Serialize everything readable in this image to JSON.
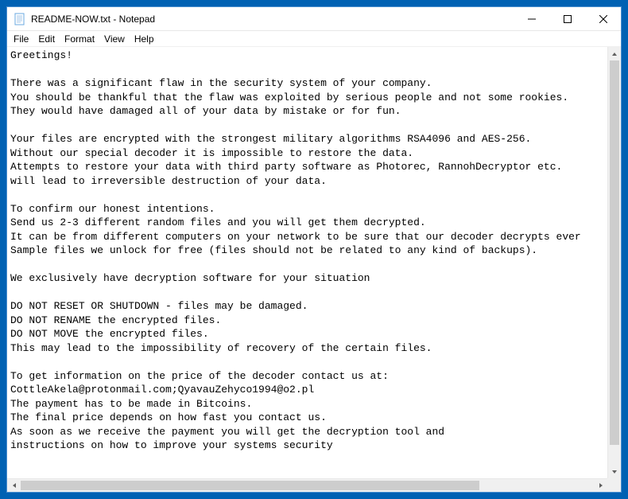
{
  "titlebar": {
    "title": "README-NOW.txt - Notepad"
  },
  "menubar": {
    "items": [
      "File",
      "Edit",
      "Format",
      "View",
      "Help"
    ]
  },
  "document": {
    "body": "Greetings!\n\nThere was a significant flaw in the security system of your company.\nYou should be thankful that the flaw was exploited by serious people and not some rookies.\nThey would have damaged all of your data by mistake or for fun.\n\nYour files are encrypted with the strongest military algorithms RSA4096 and AES-256.\nWithout our special decoder it is impossible to restore the data.\nAttempts to restore your data with third party software as Photorec, RannohDecryptor etc.\nwill lead to irreversible destruction of your data.\n\nTo confirm our honest intentions.\nSend us 2-3 different random files and you will get them decrypted.\nIt can be from different computers on your network to be sure that our decoder decrypts ever\nSample files we unlock for free (files should not be related to any kind of backups).\n\nWe exclusively have decryption software for your situation\n\nDO NOT RESET OR SHUTDOWN - files may be damaged.\nDO NOT RENAME the encrypted files.\nDO NOT MOVE the encrypted files.\nThis may lead to the impossibility of recovery of the certain files.\n\nTo get information on the price of the decoder contact us at:\nCottleAkela@protonmail.com;QyavauZehyco1994@o2.pl\nThe payment has to be made in Bitcoins.\nThe final price depends on how fast you contact us.\nAs soon as we receive the payment you will get the decryption tool and\ninstructions on how to improve your systems security"
  }
}
